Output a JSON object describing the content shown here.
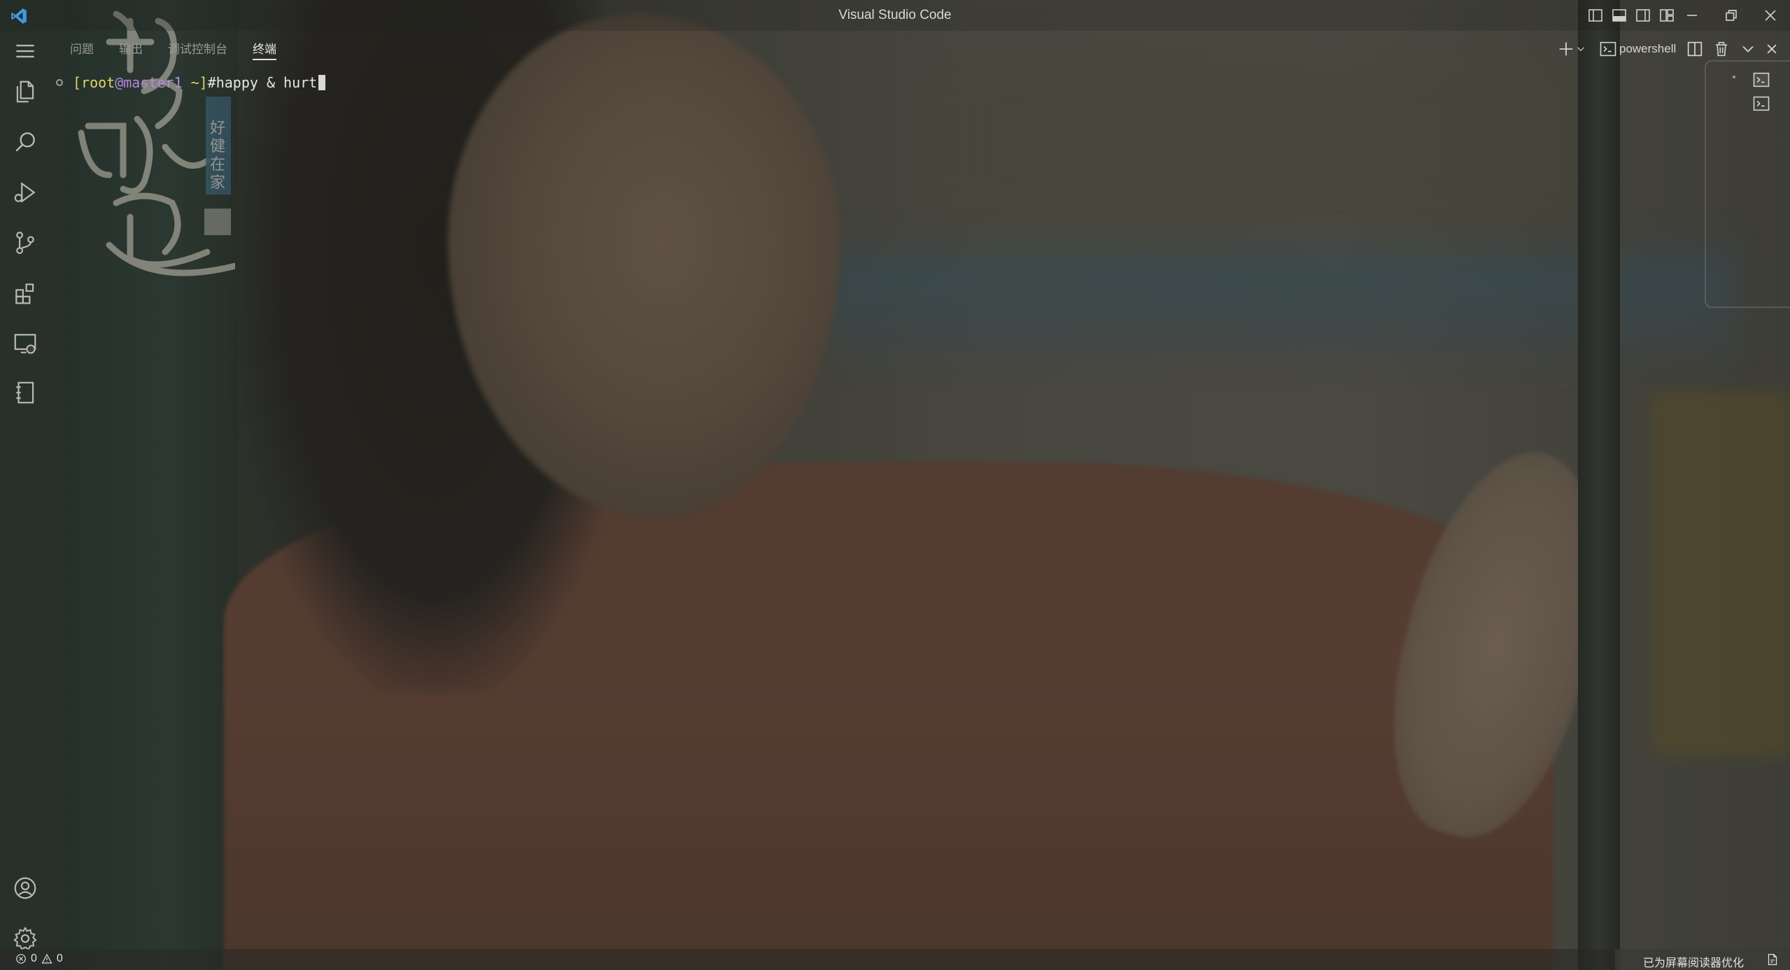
{
  "window": {
    "title": "Visual Studio Code"
  },
  "panel": {
    "tabs": [
      {
        "label": "问题"
      },
      {
        "label": "输出"
      },
      {
        "label": "调试控制台"
      },
      {
        "label": "终端"
      }
    ],
    "active_tab": "终端",
    "terminal_profile_label": "powershell"
  },
  "terminal": {
    "prompt_open": "[",
    "prompt_user": "root",
    "prompt_at": "@master1",
    "prompt_dir": " ~]",
    "command": "#happy & hurt"
  },
  "status_bar": {
    "errors": "0",
    "warnings": "0",
    "screen_reader_text": "已为屏幕阅读器优化"
  },
  "watermark": {
    "text": "好的味道 好健在家"
  },
  "colors": {
    "vscode_blue": "#3a9be0",
    "prompt_yellow": "#e2d36a",
    "prompt_purple": "#b685e0"
  }
}
